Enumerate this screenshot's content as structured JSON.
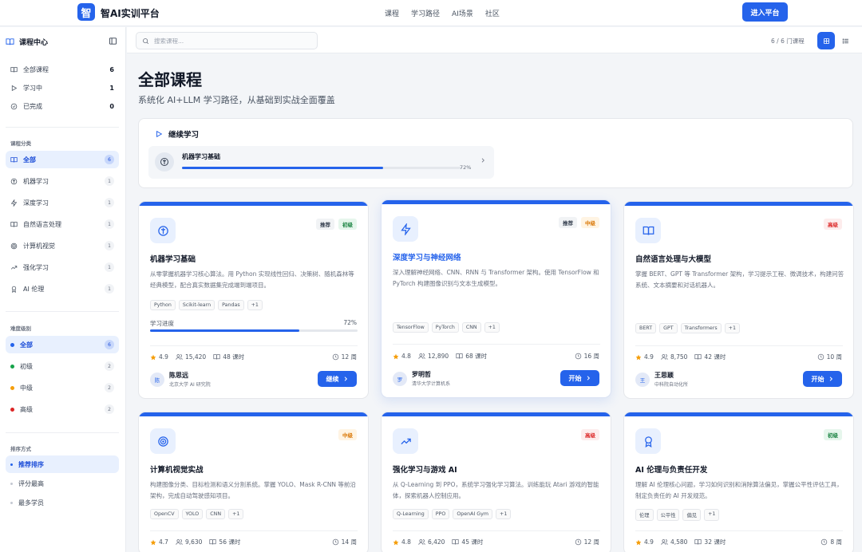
{
  "header": {
    "logo_char": "智",
    "brand": "智AI实训平台",
    "nav": [
      "课程",
      "学习路径",
      "AI场景",
      "社区"
    ],
    "enter_button": "进入平台"
  },
  "sidebar": {
    "title": "课程中心",
    "status_items": [
      {
        "label": "全部课程",
        "count": "6",
        "icon": "book-icon"
      },
      {
        "label": "学习中",
        "count": "1",
        "icon": "play-icon"
      },
      {
        "label": "已完成",
        "count": "0",
        "icon": "check-circle-icon"
      }
    ],
    "category_heading": "课程分类",
    "categories": [
      {
        "label": "全部",
        "count": "6",
        "icon": "book-icon",
        "active": true
      },
      {
        "label": "机器学习",
        "count": "1",
        "icon": "brain-icon"
      },
      {
        "label": "深度学习",
        "count": "1",
        "icon": "lightning-icon"
      },
      {
        "label": "自然语言处理",
        "count": "1",
        "icon": "book-icon"
      },
      {
        "label": "计算机视觉",
        "count": "1",
        "icon": "target-icon"
      },
      {
        "label": "强化学习",
        "count": "1",
        "icon": "trend-icon"
      },
      {
        "label": "AI 伦理",
        "count": "1",
        "icon": "award-icon"
      }
    ],
    "difficulty_heading": "难度级别",
    "difficulties": [
      {
        "label": "全部",
        "count": "6",
        "color": "#2563eb",
        "active": true
      },
      {
        "label": "初级",
        "count": "2",
        "color": "#16a34a"
      },
      {
        "label": "中级",
        "count": "2",
        "color": "#f59e0b"
      },
      {
        "label": "高级",
        "count": "2",
        "color": "#dc2626"
      }
    ],
    "sort_heading": "排序方式",
    "sorts": [
      {
        "label": "推荐排序",
        "active": true
      },
      {
        "label": "评分最高"
      },
      {
        "label": "最多学员"
      }
    ]
  },
  "toolbar": {
    "search_placeholder": "搜索课程...",
    "count_text": "6 / 6 门课程"
  },
  "page": {
    "title": "全部课程",
    "subtitle": "系统化 AI+LLM 学习路径，从基础到实战全面覆盖"
  },
  "continue": {
    "heading": "继续学习",
    "course": "机器学习基础",
    "progress": 72,
    "progress_text": "72%"
  },
  "labels": {
    "progress": "学习进度",
    "continue_btn": "继续",
    "start_btn": "开始"
  },
  "courses": [
    {
      "title": "机器学习基础",
      "icon": "brain-icon",
      "badges": [
        {
          "text": "推荐",
          "kind": "rec"
        },
        {
          "text": "初级",
          "kind": "begin"
        }
      ],
      "desc": "从零掌握机器学习核心算法。用 Python 实现线性回归、决策树、随机森林等经典模型，配合真实数据集完成端到端项目。",
      "tags": [
        "Python",
        "Scikit-learn",
        "Pandas",
        "+1"
      ],
      "progress": 72,
      "progress_text": "72%",
      "rating": "4.9",
      "students": "15,420",
      "lessons": "48 课时",
      "weeks": "12 周",
      "author": "陈思远",
      "org": "北京大学 AI 研究院",
      "avatar": "陈",
      "button": "继续"
    },
    {
      "title": "深度学习与神经网络",
      "icon": "lightning-icon",
      "highlight": true,
      "badges": [
        {
          "text": "推荐",
          "kind": "rec"
        },
        {
          "text": "中级",
          "kind": "mid"
        }
      ],
      "desc": "深入理解神经网络、CNN、RNN 与 Transformer 架构。使用 TensorFlow 和 PyTorch 构建图像识别与文本生成模型。",
      "tags": [
        "TensorFlow",
        "PyTorch",
        "CNN",
        "+1"
      ],
      "rating": "4.8",
      "students": "12,890",
      "lessons": "68 课时",
      "weeks": "16 周",
      "author": "罗明哲",
      "org": "清华大学计算机系",
      "avatar": "罗",
      "button": "开始"
    },
    {
      "title": "自然语言处理与大模型",
      "icon": "book-icon",
      "badges": [
        {
          "text": "高级",
          "kind": "adv"
        }
      ],
      "desc": "掌握 BERT、GPT 等 Transformer 架构，学习提示工程、微调技术，构建问答系统、文本摘要和对话机器人。",
      "tags": [
        "BERT",
        "GPT",
        "Transformers",
        "+1"
      ],
      "rating": "4.9",
      "students": "8,750",
      "lessons": "42 课时",
      "weeks": "10 周",
      "author": "王思颖",
      "org": "中科院自动化所",
      "avatar": "王",
      "button": "开始"
    },
    {
      "title": "计算机视觉实战",
      "icon": "target-icon",
      "badges": [
        {
          "text": "中级",
          "kind": "mid"
        }
      ],
      "desc": "构建图像分类、目标检测和语义分割系统。掌握 YOLO、Mask R-CNN 等前沿架构，完成自动驾驶感知项目。",
      "tags": [
        "OpenCV",
        "YOLO",
        "CNN",
        "+1"
      ],
      "rating": "4.7",
      "students": "9,630",
      "lessons": "56 课时",
      "weeks": "14 周"
    },
    {
      "title": "强化学习与游戏 AI",
      "icon": "trend-icon",
      "badges": [
        {
          "text": "高级",
          "kind": "adv"
        }
      ],
      "desc": "从 Q-Learning 到 PPO，系统学习强化学习算法。训练能玩 Atari 游戏的智能体，探索机器人控制应用。",
      "tags": [
        "Q-Learning",
        "PPO",
        "OpenAI Gym",
        "+1"
      ],
      "rating": "4.8",
      "students": "6,420",
      "lessons": "45 课时",
      "weeks": "12 周"
    },
    {
      "title": "AI 伦理与负责任开发",
      "icon": "award-icon",
      "badges": [
        {
          "text": "初级",
          "kind": "begin"
        }
      ],
      "desc": "理解 AI 伦理核心问题，学习如何识别和消除算法偏见，掌握公平性评估工具，制定负责任的 AI 开发规范。",
      "tags": [
        "伦理",
        "公平性",
        "偏见",
        "+1"
      ],
      "rating": "4.9",
      "students": "4,580",
      "lessons": "32 课时",
      "weeks": "8 周"
    }
  ]
}
